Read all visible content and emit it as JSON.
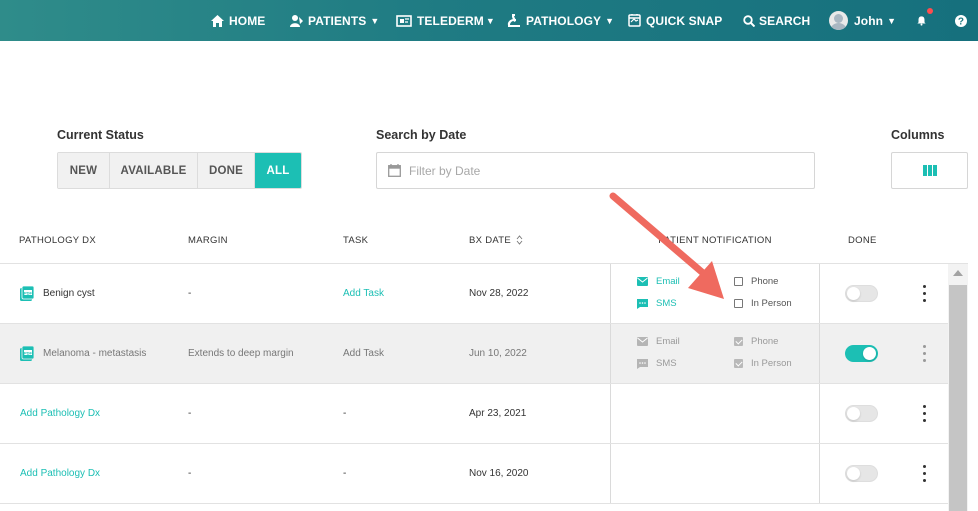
{
  "nav": {
    "home": "HOME",
    "patients": "PATIENTS",
    "telederm": "TELEDERM",
    "pathology": "PATHOLOGY",
    "quick_snap": "QUICK SNAP",
    "search": "SEARCH",
    "user": "John"
  },
  "filters": {
    "status_label": "Current Status",
    "status_options": [
      "NEW",
      "AVAILABLE",
      "DONE",
      "ALL"
    ],
    "status_selected": "ALL",
    "date_label": "Search by Date",
    "date_placeholder": "Filter by Date",
    "date_value": "",
    "columns_label": "Columns"
  },
  "table": {
    "headers": {
      "pathology_dx": "PATHOLOGY DX",
      "margin": "MARGIN",
      "task": "TASK",
      "bx_date": "BX DATE",
      "patient_notification": "PATIENT NOTIFICATION",
      "done": "DONE"
    },
    "rows": [
      {
        "pathology_dx": "Benign cyst",
        "margin": "-",
        "task": "Add Task",
        "bx_date": "Nov 28, 2022",
        "email": "Email",
        "sms": "SMS",
        "phone": "Phone",
        "in_person": "In Person",
        "phone_checked": false,
        "in_person_checked": false,
        "done": false
      },
      {
        "pathology_dx": "Melanoma - metastasis",
        "margin": "Extends to deep margin",
        "task": "Add Task",
        "bx_date": "Jun 10, 2022",
        "email": "Email",
        "sms": "SMS",
        "phone": "Phone",
        "in_person": "In Person",
        "phone_checked": true,
        "in_person_checked": true,
        "done": true
      },
      {
        "pathology_dx": "Add Pathology Dx",
        "margin": "-",
        "task": "-",
        "bx_date": "Apr 23, 2021",
        "done": false
      },
      {
        "pathology_dx": "Add Pathology Dx",
        "margin": "-",
        "task": "-",
        "bx_date": "Nov 16, 2020",
        "done": false
      }
    ]
  },
  "colors": {
    "accent": "#1cbfb4",
    "nav_bg": "#1f7b83",
    "annotation_arrow": "#ef6a5f"
  },
  "icons": [
    "home-icon",
    "patients-icon",
    "telederm-icon",
    "pathology-icon",
    "quick-snap-icon",
    "search-icon",
    "bell-icon",
    "help-icon",
    "calendar-icon",
    "columns-icon",
    "pdf-icon",
    "email-icon",
    "sms-icon",
    "sort-icon"
  ]
}
